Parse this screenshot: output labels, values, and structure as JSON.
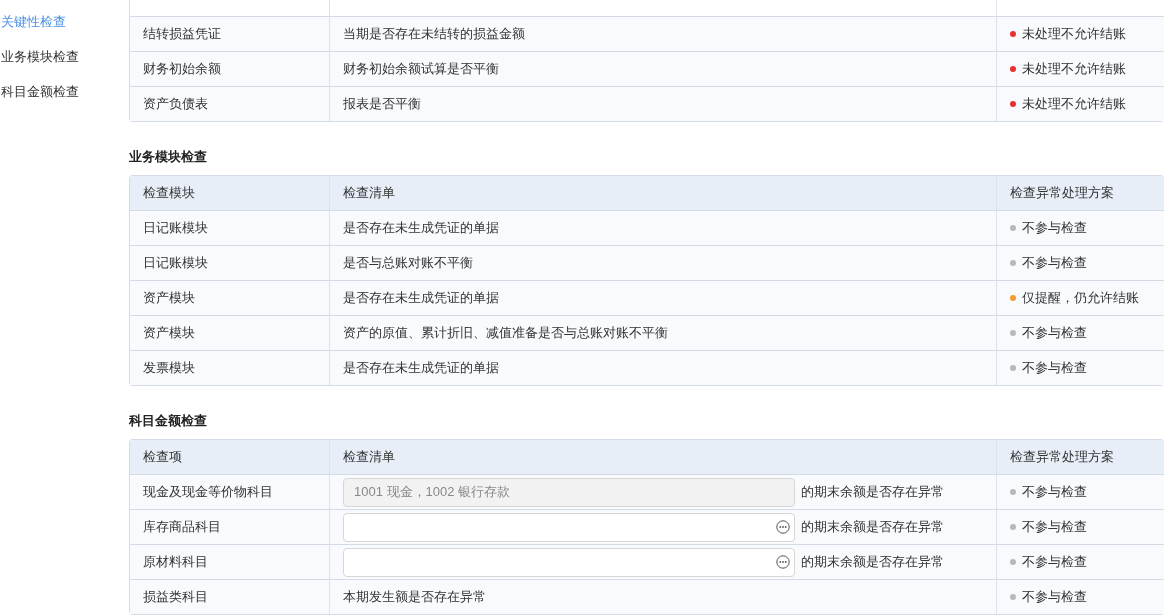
{
  "sidebar": {
    "items": [
      {
        "label": "关键性检查",
        "selected": true
      },
      {
        "label": "业务模块检查",
        "selected": false
      },
      {
        "label": "科目金额检查",
        "selected": false
      }
    ]
  },
  "sections": [
    {
      "rows": [
        {
          "item": "结转损益凭证",
          "kind": "text",
          "check": "当期是否存在未结转的损益金额",
          "plan": "未处理不允许结账",
          "color": "#e8312f"
        },
        {
          "item": "财务初始余额",
          "kind": "text",
          "check": "财务初始余额试算是否平衡",
          "plan": "未处理不允许结账",
          "color": "#e8312f"
        },
        {
          "item": "资产负债表",
          "kind": "text",
          "check": "报表是否平衡",
          "plan": "未处理不允许结账",
          "color": "#e8312f"
        }
      ]
    },
    {
      "title": "业务模块检查",
      "columns": [
        "检查模块",
        "检查清单",
        "检查异常处理方案"
      ],
      "rows": [
        {
          "item": "日记账模块",
          "kind": "text",
          "check": "是否存在未生成凭证的单据",
          "plan": "不参与检查",
          "color": "#b8b8b8"
        },
        {
          "item": "日记账模块",
          "kind": "text",
          "check": "是否与总账对账不平衡",
          "plan": "不参与检查",
          "color": "#b8b8b8"
        },
        {
          "item": "资产模块",
          "kind": "text",
          "check": "是否存在未生成凭证的单据",
          "plan": "仅提醒，仍允许结账",
          "color": "#f59a2e"
        },
        {
          "item": "资产模块",
          "kind": "text",
          "check": "资产的原值、累计折旧、减值准备是否与总账对账不平衡",
          "plan": "不参与检查",
          "color": "#b8b8b8"
        },
        {
          "item": "发票模块",
          "kind": "text",
          "check": "是否存在未生成凭证的单据",
          "plan": "不参与检查",
          "color": "#b8b8b8"
        }
      ]
    },
    {
      "title": "科目金额检查",
      "columns": [
        "检查项",
        "检查清单",
        "检查异常处理方案"
      ],
      "rows": [
        {
          "item": "现金及现金等价物科目",
          "kind": "input",
          "field": {
            "value": "1001 现金，1002 银行存款",
            "disabled": true
          },
          "suffix": "的期末余额是否存在异常",
          "plan": "不参与检查",
          "color": "#b8b8b8"
        },
        {
          "item": "库存商品科目",
          "kind": "input",
          "field": {
            "disabled": false
          },
          "suffix": "的期末余额是否存在异常",
          "plan": "不参与检查",
          "color": "#b8b8b8"
        },
        {
          "item": "原材料科目",
          "kind": "input",
          "field": {
            "disabled": false
          },
          "suffix": "的期末余额是否存在异常",
          "plan": "不参与检查",
          "color": "#b8b8b8"
        },
        {
          "item": "损益类科目",
          "kind": "text",
          "check": "本期发生额是否存在异常",
          "plan": "不参与检查",
          "color": "#b8b8b8"
        }
      ]
    }
  ]
}
